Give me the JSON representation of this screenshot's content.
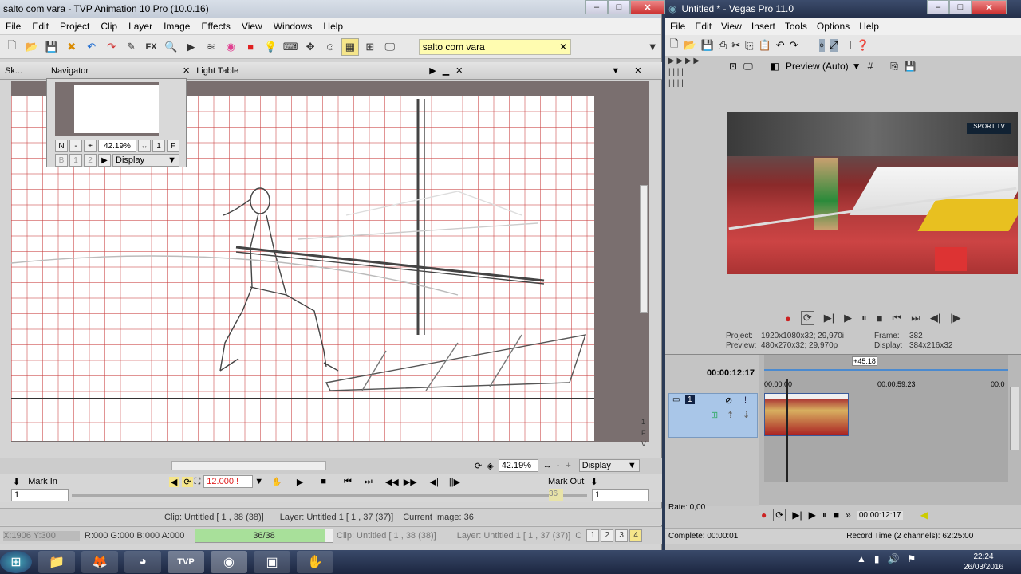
{
  "tvp": {
    "title": "salto com vara - TVP Animation 10 Pro (10.0.16)",
    "menu": [
      "File",
      "Edit",
      "Project",
      "Clip",
      "Layer",
      "Image",
      "Effects",
      "View",
      "Windows",
      "Help"
    ],
    "project_tab": "salto com vara",
    "sketch_tab": "Sk...",
    "navigator": {
      "title": "Navigator",
      "zoom": "42.19%",
      "n_btn": "N",
      "minus_btn": "-",
      "plus_btn": "+",
      "one_btn": "1",
      "f_btn": "F",
      "display": "Display",
      "b_btns": [
        "B",
        "1",
        "2"
      ]
    },
    "lighttable_title": "Light Table",
    "bottom": {
      "zoom": "42.19%",
      "display": "Display",
      "mark_in": "Mark In",
      "mark_out": "Mark Out",
      "fps": "12.000 !",
      "frame_left": "1",
      "frame_right": "1",
      "frame_marker": "36",
      "clip_status": "Clip: Untitled [ 1 , 38  (38)]",
      "layer_status": "Layer: Untitled 1 [ 1 , 37  (37)]",
      "current_image": "Current Image: 36",
      "coords": "X:1906  Y:300",
      "rgba": "R:000 G:000 B:000 A:000",
      "progress": "36/38",
      "progress_fraction": 0.947,
      "clip2": "Clip: Untitled [ 1 , 38  (38)]",
      "layer2": "Layer: Untitled 1 [ 1 , 37  (37)]",
      "c_label": "C",
      "pages": [
        "1",
        "2",
        "3",
        "4"
      ]
    }
  },
  "vegas": {
    "title": "Untitled * - Vegas Pro 11.0",
    "menu": [
      "File",
      "Edit",
      "View",
      "Insert",
      "Tools",
      "Options",
      "Help"
    ],
    "preview_mode": "Preview (Auto)",
    "project_label": "Project:",
    "project_val": "1920x1080x32; 29,970i",
    "preview_label": "Preview:",
    "preview_val": "480x270x32; 29,970p",
    "frame_label": "Frame:",
    "frame_val": "382",
    "display_label": "Display:",
    "display_val": "384x216x32",
    "time_cursor": "00:00:12:17",
    "offset": "+45:18",
    "ruler": [
      "00:00:00",
      "00:00:59:23",
      "00:0"
    ],
    "track_num": "1",
    "rate": "Rate: 0,00",
    "transport_time": "00:00:12:17",
    "complete": "Complete: 00:00:01",
    "record_time": "Record Time (2 channels): 62:25:00",
    "tv_logo": "SPORT TV"
  },
  "taskbar": {
    "time": "22:24",
    "date": "26/03/2016",
    "apps": [
      "start-orb",
      "explorer",
      "firefox",
      "chrome",
      "tvpaint",
      "vegas",
      "window",
      "paw"
    ]
  },
  "colors": {
    "accent_red": "#c83c3c",
    "timeline_blue": "#a9c6e8",
    "progress_green": "#a8e09a"
  }
}
